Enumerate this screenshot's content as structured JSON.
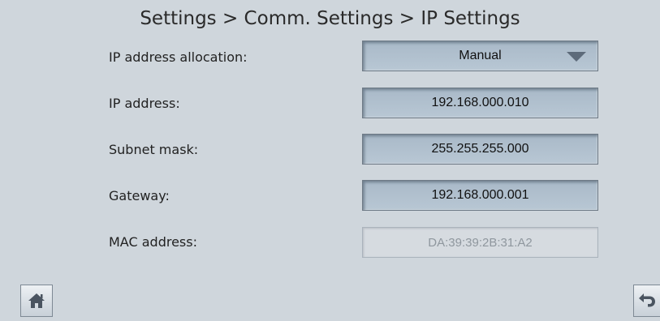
{
  "header": {
    "breadcrumb": "Settings > Comm. Settings > IP Settings"
  },
  "rows": [
    {
      "label": "IP address allocation:",
      "value": "Manual",
      "type": "dropdown"
    },
    {
      "label": "IP address:",
      "value": "192.168.000.010",
      "type": "input"
    },
    {
      "label": "Subnet mask:",
      "value": "255.255.255.000",
      "type": "input"
    },
    {
      "label": "Gateway:",
      "value": "192.168.000.001",
      "type": "input"
    },
    {
      "label": "MAC address:",
      "value": "DA:39:39:2B:31:A2",
      "type": "readonly"
    }
  ],
  "footer": {
    "home_icon": "home-icon",
    "back_icon": "back-arrow-icon"
  },
  "colors": {
    "background": "#cfd6dc",
    "field": "#b0c0ce",
    "arrow": "#5d6b7a"
  }
}
